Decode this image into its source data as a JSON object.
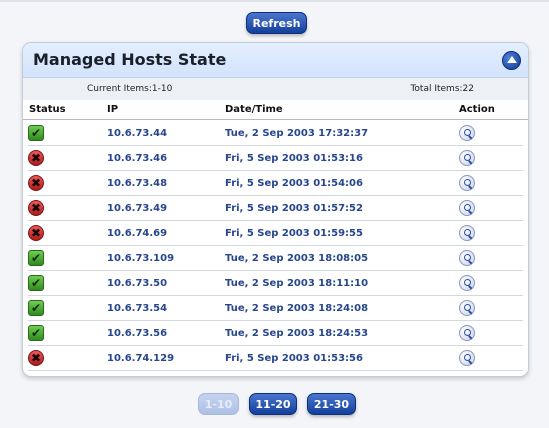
{
  "toolbar": {
    "refresh_label": "Refresh"
  },
  "panel": {
    "title": "Managed Hosts State",
    "current_items": "Current Items:1-10",
    "total_items": "Total Items:22",
    "columns": {
      "status": "Status",
      "ip": "IP",
      "datetime": "Date/Time",
      "action": "Action"
    },
    "rows": [
      {
        "status": "ok",
        "ip": "10.6.73.44",
        "datetime": "Tue, 2 Sep 2003 17:32:37"
      },
      {
        "status": "down",
        "ip": "10.6.73.46",
        "datetime": "Fri, 5 Sep 2003 01:53:16"
      },
      {
        "status": "down",
        "ip": "10.6.73.48",
        "datetime": "Fri, 5 Sep 2003 01:54:06"
      },
      {
        "status": "down",
        "ip": "10.6.73.49",
        "datetime": "Fri, 5 Sep 2003 01:57:52"
      },
      {
        "status": "down",
        "ip": "10.6.74.69",
        "datetime": "Fri, 5 Sep 2003 01:59:55"
      },
      {
        "status": "ok",
        "ip": "10.6.73.109",
        "datetime": "Tue, 2 Sep 2003 18:08:05"
      },
      {
        "status": "ok",
        "ip": "10.6.73.50",
        "datetime": "Tue, 2 Sep 2003 18:11:10"
      },
      {
        "status": "ok",
        "ip": "10.6.73.54",
        "datetime": "Tue, 2 Sep 2003 18:24:08"
      },
      {
        "status": "ok",
        "ip": "10.6.73.56",
        "datetime": "Tue, 2 Sep 2003 18:24:53"
      },
      {
        "status": "down",
        "ip": "10.6.74.129",
        "datetime": "Fri, 5 Sep 2003 01:53:56"
      }
    ]
  },
  "pagination": {
    "pages": [
      {
        "label": "1-10",
        "active": false
      },
      {
        "label": "11-20",
        "active": true
      },
      {
        "label": "21-30",
        "active": true
      }
    ]
  },
  "colors": {
    "accent": "#1a46a6",
    "link": "#27468e",
    "ok": "#3a9a26",
    "down": "#c42424"
  }
}
